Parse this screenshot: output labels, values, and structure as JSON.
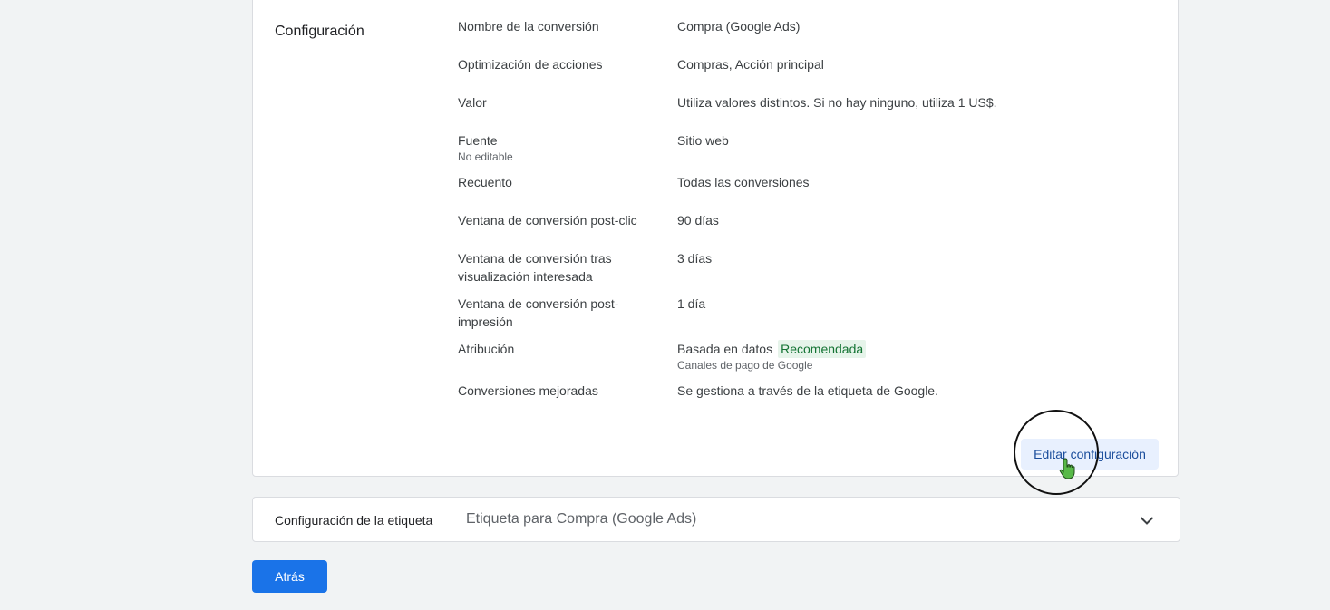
{
  "config": {
    "section_title": "Configuración",
    "rows": [
      {
        "label": "Nombre de la conversión",
        "sub": "",
        "value": "Compra (Google Ads)",
        "badge": "",
        "value_sub": ""
      },
      {
        "label": "Optimización de acciones",
        "sub": "",
        "value": "Compras, Acción principal",
        "badge": "",
        "value_sub": ""
      },
      {
        "label": "Valor",
        "sub": "",
        "value": "Utiliza valores distintos. Si no hay ninguno, utiliza 1 US$.",
        "badge": "",
        "value_sub": ""
      },
      {
        "label": "Fuente",
        "sub": "No editable",
        "value": "Sitio web",
        "badge": "",
        "value_sub": ""
      },
      {
        "label": "Recuento",
        "sub": "",
        "value": "Todas las conversiones",
        "badge": "",
        "value_sub": ""
      },
      {
        "label": "Ventana de conversión post-clic",
        "sub": "",
        "value": "90 días",
        "badge": "",
        "value_sub": ""
      },
      {
        "label": "Ventana de conversión tras visualización interesada",
        "sub": "",
        "value": "3 días",
        "badge": "",
        "value_sub": ""
      },
      {
        "label": "Ventana de conversión post-impresión",
        "sub": "",
        "value": "1 día",
        "badge": "",
        "value_sub": ""
      },
      {
        "label": "Atribución",
        "sub": "",
        "value": "Basada en datos",
        "badge": "Recomendada",
        "value_sub": "Canales de pago de Google"
      },
      {
        "label": "Conversiones mejoradas",
        "sub": "",
        "value": "Se gestiona a través de la etiqueta de Google.",
        "badge": "",
        "value_sub": ""
      }
    ],
    "edit_label": "Editar configuración"
  },
  "tag": {
    "title": "Configuración de la etiqueta",
    "value": "Etiqueta para Compra (Google Ads)",
    "icon": "chevron-down-icon"
  },
  "back_label": "Atrás",
  "colors": {
    "primary": "#1a73e8",
    "badge_bg": "#e6f4ea",
    "badge_text": "#137333",
    "background": "#f1f3f4"
  }
}
